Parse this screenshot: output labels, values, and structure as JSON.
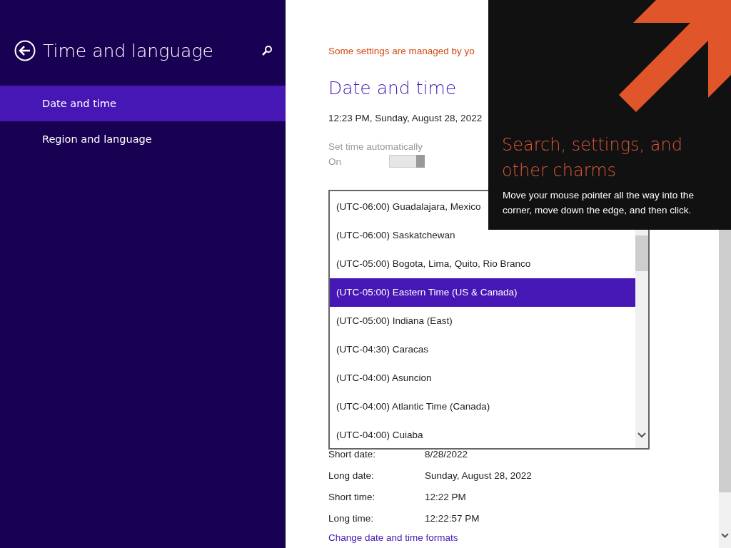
{
  "sidebar": {
    "title": "Time and language",
    "items": [
      {
        "label": "Date and time",
        "selected": true
      },
      {
        "label": "Region and language",
        "selected": false
      }
    ]
  },
  "main": {
    "notice": "Some settings are managed by yo",
    "heading": "Date and time",
    "clock": "12:23 PM, Sunday, August 28, 2022",
    "auto_time": {
      "label": "Set time automatically",
      "state": "On",
      "on": true
    },
    "formats": [
      {
        "label": "Short date:",
        "value": "8/28/2022"
      },
      {
        "label": "Long date:",
        "value": "Sunday, August 28, 2022"
      },
      {
        "label": "Short time:",
        "value": "12:22 PM"
      },
      {
        "label": "Long time:",
        "value": "12:22:57 PM"
      }
    ],
    "link": "Change date and time formats"
  },
  "time_zone_list": {
    "items": [
      {
        "label": "(UTC-06:00) Guadalajara, Mexico",
        "selected": false
      },
      {
        "label": "(UTC-06:00) Saskatchewan",
        "selected": false
      },
      {
        "label": "(UTC-05:00) Bogota, Lima, Quito, Rio Branco",
        "selected": false
      },
      {
        "label": "(UTC-05:00) Eastern Time (US & Canada)",
        "selected": true
      },
      {
        "label": "(UTC-05:00) Indiana (East)",
        "selected": false
      },
      {
        "label": "(UTC-04:30) Caracas",
        "selected": false
      },
      {
        "label": "(UTC-04:00) Asuncion",
        "selected": false
      },
      {
        "label": "(UTC-04:00) Atlantic Time (Canada)",
        "selected": false
      },
      {
        "label": "(UTC-04:00) Cuiaba",
        "selected": false
      }
    ]
  },
  "charm_tip": {
    "title": "Search, settings, and other charms",
    "text": "Move your mouse pointer all the way into the corner, move down the edge, and then click."
  }
}
